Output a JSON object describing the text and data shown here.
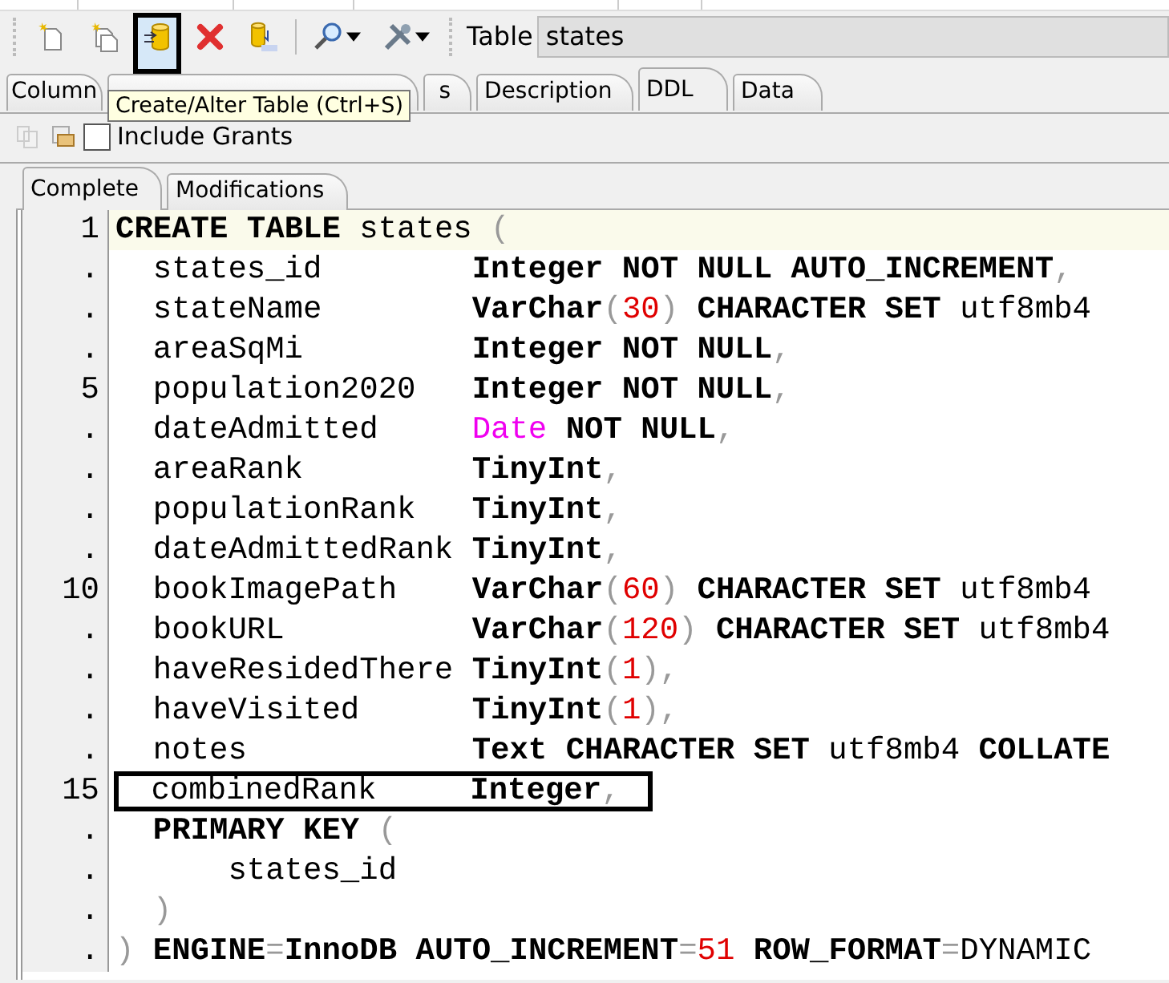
{
  "toolbar": {
    "buttons": [
      {
        "kind": "new_table",
        "boxed": false,
        "dropdown": false
      },
      {
        "kind": "copy_table",
        "boxed": false,
        "dropdown": false
      },
      {
        "kind": "create_alter",
        "boxed": true,
        "dropdown": false
      },
      {
        "kind": "delete",
        "boxed": false,
        "dropdown": false
      },
      {
        "kind": "ddl",
        "boxed": false,
        "dropdown": false
      },
      {
        "kind": "search",
        "boxed": false,
        "dropdown": true
      },
      {
        "kind": "tools",
        "boxed": false,
        "dropdown": true
      }
    ],
    "table_label": "Table",
    "table_value": "states"
  },
  "tooltip": "Create/Alter Table (Ctrl+S)",
  "tabs": [
    {
      "label": "Column",
      "selected": false
    },
    {
      "selected": false
    },
    {
      "label": "s",
      "selected": false
    },
    {
      "label": "Description",
      "selected": false
    },
    {
      "label": "DDL",
      "selected": true
    },
    {
      "label": "Data",
      "selected": false
    }
  ],
  "ddl_toolbar": {
    "buttons": [
      {
        "kind": "copy",
        "disabled": true
      },
      {
        "kind": "save",
        "disabled": false
      }
    ],
    "include_grants": {
      "label": "Include Grants",
      "checked": false
    }
  },
  "subtabs": [
    {
      "label": "Complete",
      "selected": true
    },
    {
      "label": "Modifications",
      "selected": false
    }
  ],
  "code": [
    {
      "gutter": "1",
      "kind": "statement",
      "current": true,
      "boxed": false,
      "tokens": [
        {
          "kind": "kw",
          "t": "CREATE TABLE"
        },
        {
          "kind": "plain",
          "t": " states"
        },
        {
          "kind": "punct",
          "t": " ("
        }
      ]
    },
    {
      "gutter": ".",
      "kind": "column",
      "current": false,
      "boxed": false,
      "name": "states_id",
      "tokens": [
        {
          "kind": "kw",
          "t": "Integer NOT NULL AUTO_INCREMENT"
        },
        {
          "kind": "punct",
          "t": ","
        }
      ]
    },
    {
      "gutter": ".",
      "kind": "column",
      "current": false,
      "boxed": false,
      "name": "stateName",
      "tokens": [
        {
          "kind": "kw",
          "t": "VarChar"
        },
        {
          "kind": "punct",
          "t": "("
        },
        {
          "kind": "num",
          "t": "30"
        },
        {
          "kind": "punct",
          "t": ")"
        },
        {
          "kind": "kw",
          "t": " CHARACTER SET"
        },
        {
          "kind": "plain",
          "t": " utf8mb4"
        }
      ]
    },
    {
      "gutter": ".",
      "kind": "column",
      "current": false,
      "boxed": false,
      "name": "areaSqMi",
      "tokens": [
        {
          "kind": "kw",
          "t": "Integer NOT NULL"
        },
        {
          "kind": "punct",
          "t": ","
        }
      ]
    },
    {
      "gutter": "5",
      "kind": "column",
      "current": false,
      "boxed": false,
      "name": "population2020",
      "tokens": [
        {
          "kind": "kw",
          "t": "Integer NOT NULL"
        },
        {
          "kind": "punct",
          "t": ","
        }
      ]
    },
    {
      "gutter": ".",
      "kind": "column",
      "current": false,
      "boxed": false,
      "name": "dateAdmitted",
      "tokens": [
        {
          "kind": "type",
          "t": "Date"
        },
        {
          "kind": "kw",
          "t": " NOT NULL"
        },
        {
          "kind": "punct",
          "t": ","
        }
      ]
    },
    {
      "gutter": ".",
      "kind": "column",
      "current": false,
      "boxed": false,
      "name": "areaRank",
      "tokens": [
        {
          "kind": "kw",
          "t": "TinyInt"
        },
        {
          "kind": "punct",
          "t": ","
        }
      ]
    },
    {
      "gutter": ".",
      "kind": "column",
      "current": false,
      "boxed": false,
      "name": "populationRank",
      "tokens": [
        {
          "kind": "kw",
          "t": "TinyInt"
        },
        {
          "kind": "punct",
          "t": ","
        }
      ]
    },
    {
      "gutter": ".",
      "kind": "column",
      "current": false,
      "boxed": false,
      "name": "dateAdmittedRank",
      "tokens": [
        {
          "kind": "kw",
          "t": "TinyInt"
        },
        {
          "kind": "punct",
          "t": ","
        }
      ]
    },
    {
      "gutter": "10",
      "kind": "column",
      "current": false,
      "boxed": false,
      "name": "bookImagePath",
      "tokens": [
        {
          "kind": "kw",
          "t": "VarChar"
        },
        {
          "kind": "punct",
          "t": "("
        },
        {
          "kind": "num",
          "t": "60"
        },
        {
          "kind": "punct",
          "t": ")"
        },
        {
          "kind": "kw",
          "t": " CHARACTER SET"
        },
        {
          "kind": "plain",
          "t": " utf8mb4"
        }
      ]
    },
    {
      "gutter": ".",
      "kind": "column",
      "current": false,
      "boxed": false,
      "name": "bookURL",
      "tokens": [
        {
          "kind": "kw",
          "t": "VarChar"
        },
        {
          "kind": "punct",
          "t": "("
        },
        {
          "kind": "num",
          "t": "120"
        },
        {
          "kind": "punct",
          "t": ")"
        },
        {
          "kind": "kw",
          "t": " CHARACTER SET"
        },
        {
          "kind": "plain",
          "t": " utf8mb4"
        }
      ]
    },
    {
      "gutter": ".",
      "kind": "column",
      "current": false,
      "boxed": false,
      "name": "haveResidedThere",
      "tokens": [
        {
          "kind": "kw",
          "t": "TinyInt"
        },
        {
          "kind": "punct",
          "t": "("
        },
        {
          "kind": "num",
          "t": "1"
        },
        {
          "kind": "punct",
          "t": "),"
        }
      ]
    },
    {
      "gutter": ".",
      "kind": "column",
      "current": false,
      "boxed": false,
      "name": "haveVisited",
      "tokens": [
        {
          "kind": "kw",
          "t": "TinyInt"
        },
        {
          "kind": "punct",
          "t": "("
        },
        {
          "kind": "num",
          "t": "1"
        },
        {
          "kind": "punct",
          "t": "),"
        }
      ]
    },
    {
      "gutter": ".",
      "kind": "column",
      "current": false,
      "boxed": false,
      "name": "notes",
      "tokens": [
        {
          "kind": "kw",
          "t": "Text CHARACTER SET"
        },
        {
          "kind": "plain",
          "t": " utf8mb4"
        },
        {
          "kind": "kw",
          "t": " COLLATE"
        }
      ]
    },
    {
      "gutter": "15",
      "kind": "column",
      "current": false,
      "boxed": true,
      "name": "combinedRank",
      "tokens": [
        {
          "kind": "kw",
          "t": "Integer"
        },
        {
          "kind": "punct",
          "t": ","
        }
      ]
    },
    {
      "gutter": ".",
      "kind": "key",
      "current": false,
      "boxed": false,
      "tokens": [
        {
          "kind": "kw",
          "t": "PRIMARY KEY"
        },
        {
          "kind": "punct",
          "t": " ("
        }
      ]
    },
    {
      "gutter": ".",
      "kind": "key_column",
      "current": false,
      "boxed": false,
      "tokens": [
        {
          "kind": "plain",
          "t": "states_id"
        }
      ]
    },
    {
      "gutter": ".",
      "kind": "close",
      "current": false,
      "boxed": false,
      "tokens": [
        {
          "kind": "punct",
          "t": ")"
        }
      ]
    },
    {
      "gutter": ".",
      "kind": "statement",
      "current": false,
      "boxed": false,
      "tokens": [
        {
          "kind": "punct",
          "t": ")"
        },
        {
          "kind": "kw",
          "t": " ENGINE"
        },
        {
          "kind": "punct",
          "t": "="
        },
        {
          "kind": "kw",
          "t": "InnoDB AUTO_INCREMENT"
        },
        {
          "kind": "punct",
          "t": "="
        },
        {
          "kind": "num",
          "t": "51"
        },
        {
          "kind": "kw",
          "t": " ROW_FORMAT"
        },
        {
          "kind": "punct",
          "t": "="
        },
        {
          "kind": "plain",
          "t": "DYNAMIC"
        }
      ]
    }
  ]
}
